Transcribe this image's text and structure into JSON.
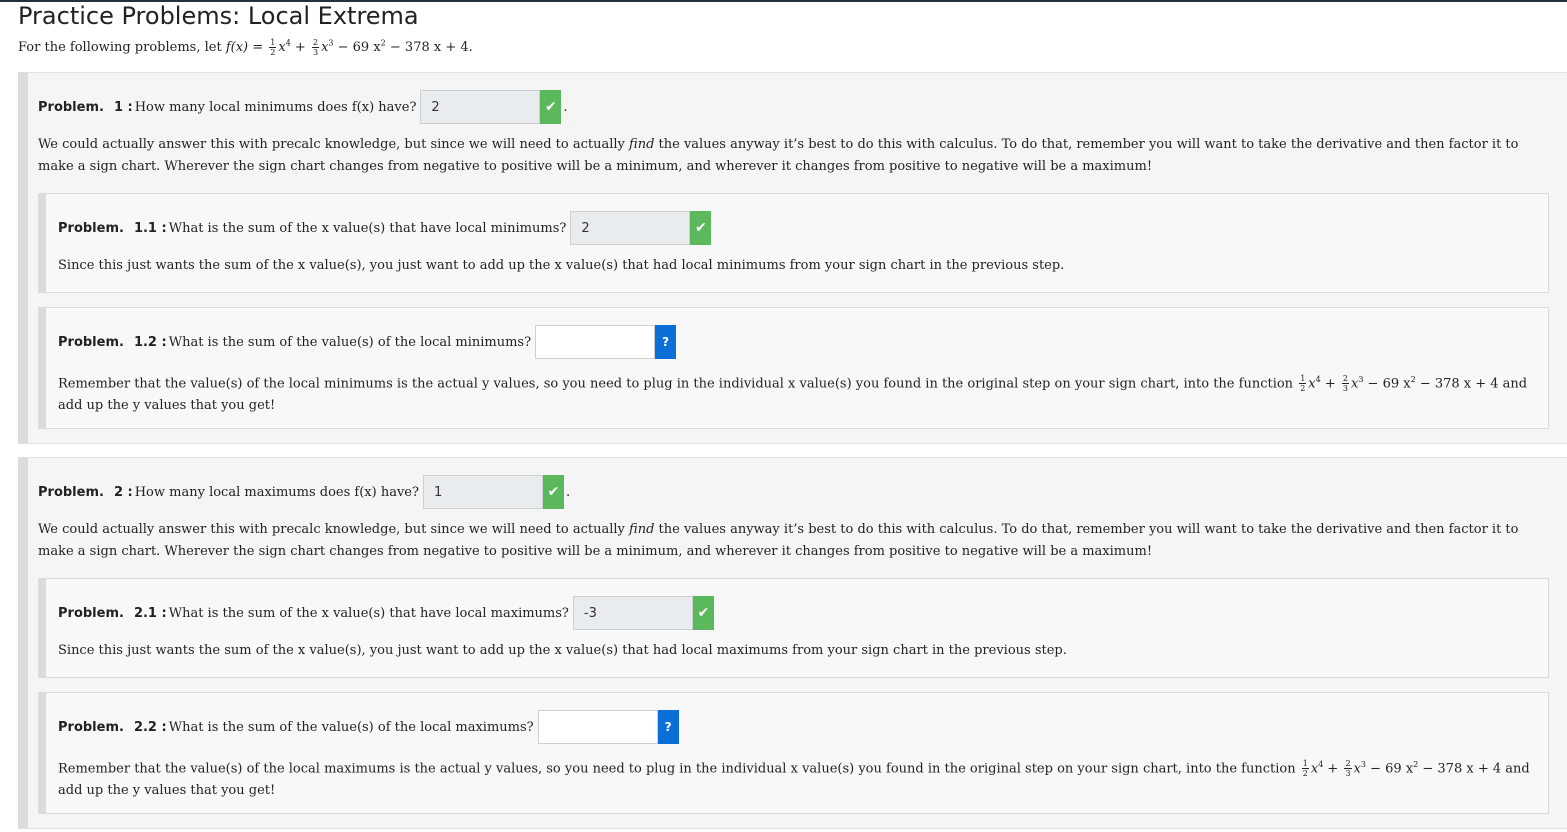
{
  "page": {
    "title": "Practice Problems: Local Extrema",
    "intro_prefix": "For the following problems, let ",
    "fx": "f(x) = ",
    "frac_1_num": "1",
    "frac_1_den": "2",
    "term_1": "x",
    "exp_4": "4",
    "plus": " + ",
    "frac_2_num": "2",
    "frac_2_den": "3",
    "term_2": "x",
    "exp_3": "3",
    "rest": " − 69 x",
    "exp_2": "2",
    "tail": " − 378 x + 4."
  },
  "problems": [
    {
      "label": "Problem.",
      "number": "1 :",
      "question": "How many local minimums does f(x) have?",
      "answer": "2",
      "status": "correct",
      "hint_1": "We could actually answer this with precalc knowledge, but since we will need to actually ",
      "hint_em": "find",
      "hint_2": " the values anyway it’s best to do this with calculus. To do that, remember you will want to take the derivative and then factor it to make a sign chart. Wherever the sign chart changes from negative to positive will be a minimum, and wherever it changes from positive to negative will be a maximum!",
      "subs": [
        {
          "label": "Problem.",
          "number": "1.1 :",
          "question": "What is the sum of the x value(s) that have local minimums?",
          "answer": "2",
          "status": "correct",
          "hint": "Since this just wants the sum of the x value(s), you just want to add up the x value(s) that had local minimums from your sign chart in the previous step."
        },
        {
          "label": "Problem.",
          "number": "1.2 :",
          "question": "What is the sum of the value(s) of the local minimums?",
          "answer": "",
          "status": "help",
          "hint_1": "Remember that the value(s) of the local minimums is the actual y values, so you need to plug in the individual x value(s) you found in the original step on your sign chart, into the function ",
          "hint_2": " − 69 x",
          "hint_3": " − 378 x + 4 and add up the y values that you get!"
        }
      ]
    },
    {
      "label": "Problem.",
      "number": "2 :",
      "question": "How many local maximums does f(x) have?",
      "answer": "1",
      "status": "correct",
      "hint_1": "We could actually answer this with precalc knowledge, but since we will need to actually ",
      "hint_em": "find",
      "hint_2": " the values anyway it’s best to do this with calculus. To do that, remember you will want to take the derivative and then factor it to make a sign chart. Wherever the sign chart changes from negative to positive will be a minimum, and wherever it changes from positive to negative will be a maximum!",
      "subs": [
        {
          "label": "Problem.",
          "number": "2.1 :",
          "question": "What is the sum of the x value(s) that have local maximums?",
          "answer": "-3",
          "status": "correct",
          "hint": "Since this just wants the sum of the x value(s), you just want to add up the x value(s) that had local maximums from your sign chart in the previous step."
        },
        {
          "label": "Problem.",
          "number": "2.2 :",
          "question": "What is the sum of the value(s) of the local maximums?",
          "answer": "",
          "status": "help",
          "hint_1": "Remember that the value(s) of the local maximums is the actual y values, so you need to plug in the individual x value(s) you found in the original step on your sign chart, into the function ",
          "hint_2": " − 69 x",
          "hint_3": " − 378 x + 4 and add up the y values that you get!"
        }
      ]
    }
  ],
  "icons": {
    "correct": "check-icon",
    "help": "question-icon"
  },
  "glyphs": {
    "check": "✔",
    "help": "?",
    "period": "."
  },
  "colors": {
    "correct": "#5cb85c",
    "help": "#0a6fd6",
    "panel": "#f5f5f5",
    "border": "#dcdcdc"
  }
}
